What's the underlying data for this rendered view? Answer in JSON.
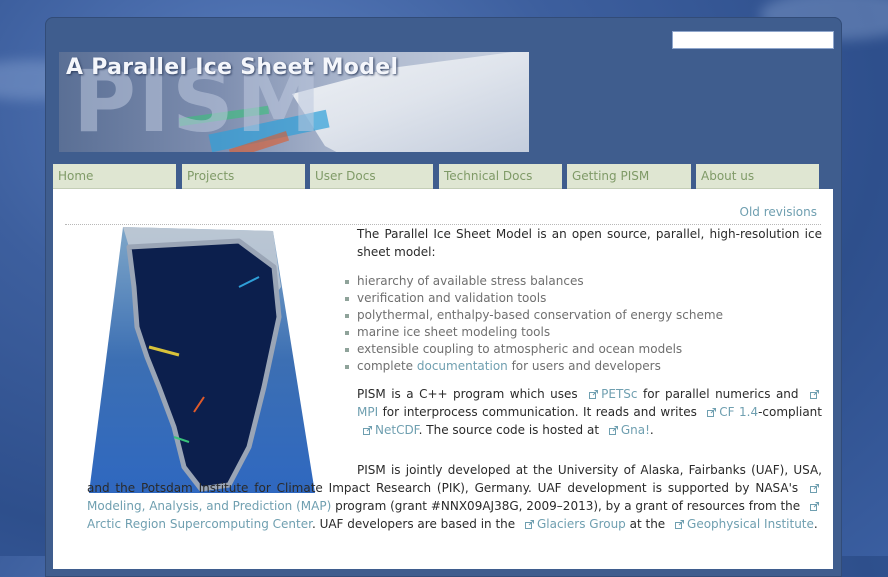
{
  "site": {
    "banner_title": "A Parallel Ice Sheet Model",
    "banner_logo_text": "PISM",
    "search_placeholder": ""
  },
  "nav": {
    "items": [
      {
        "label": "Home"
      },
      {
        "label": "Projects"
      },
      {
        "label": "User Docs"
      },
      {
        "label": "Technical Docs"
      },
      {
        "label": "Getting PISM"
      },
      {
        "label": "About us"
      }
    ]
  },
  "page": {
    "old_revisions": "Old revisions",
    "intro": "The Parallel Ice Sheet Model is an open source, parallel, high-resolution ice sheet model:",
    "features": [
      "hierarchy of available stress balances",
      "verification and validation tools",
      "polythermal, enthalpy-based conservation of energy scheme",
      "marine ice sheet modeling tools",
      "extensible coupling to atmospheric and ocean models"
    ],
    "feature_last_pre": "complete ",
    "feature_last_link": "documentation",
    "feature_last_post": " for users and developers",
    "p2": {
      "t1": "PISM is a C++ program which uses ",
      "petsc": "PETSc",
      "t2": " for parallel numerics and ",
      "mpi": "MPI",
      "t3": " for interprocess communication. It reads and writes ",
      "cf": "CF 1.4",
      "t4": "-compliant ",
      "netcdf": "NetCDF",
      "t5": ". The source code is hosted at ",
      "gna": "Gna!",
      "t6": "."
    },
    "p3": {
      "t1": "PISM is jointly developed at the University of Alaska, Fairbanks (UAF), USA, and the Potsdam Institute for Climate Impact Research (PIK), Germany. UAF development is supported by NASA's ",
      "map": "Modeling, Analysis, and Prediction (MAP)",
      "t2": " program (grant #NNX09AJ38G, 2009–2013), by a grant of resources from the ",
      "arsc": "Arctic Region Supercomputing Center",
      "t3": ". UAF developers are based in the ",
      "glaciers": "Glaciers Group",
      "t4": " at the ",
      "gi": "Geophysical Institute",
      "t5": "."
    }
  },
  "colors": {
    "nav_bg": "#dfe6d2",
    "nav_text": "#7f9a67",
    "link": "#6f9fb0",
    "frame": "#3f5d8e"
  }
}
